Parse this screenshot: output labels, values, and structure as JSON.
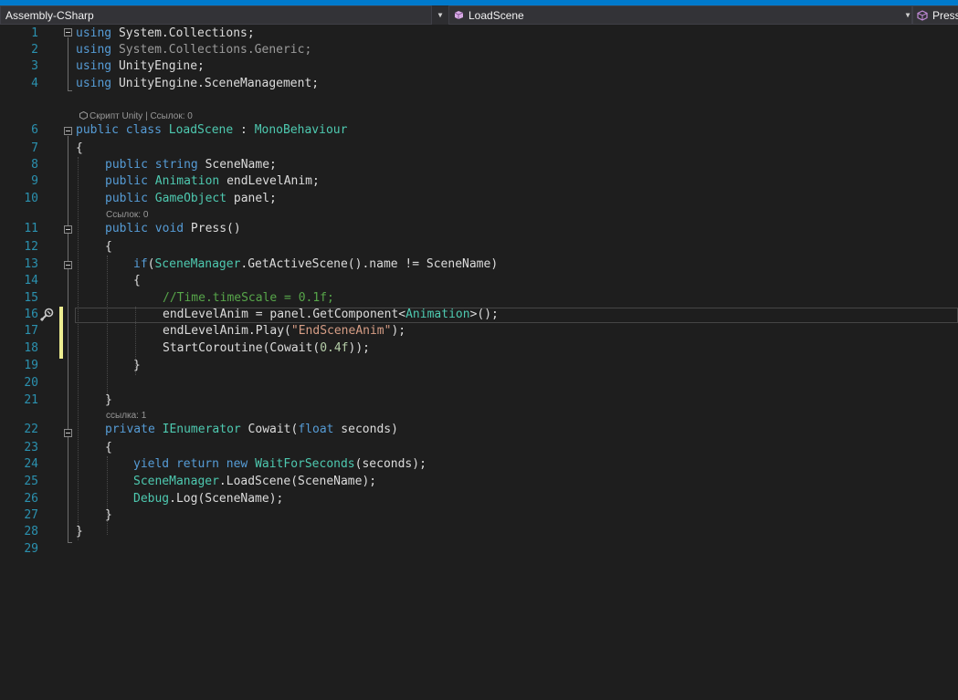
{
  "navbar": {
    "project": "Assembly-CSharp",
    "class_name": "LoadScene",
    "member": "Press"
  },
  "code_lens": {
    "class": "Скрипт Unity | Ссылок: 0",
    "press": "Ссылок: 0",
    "cowait": "ссылка: 1"
  },
  "line_numbers": [
    "1",
    "2",
    "3",
    "4",
    "6",
    "7",
    "8",
    "9",
    "10",
    "11",
    "12",
    "13",
    "14",
    "15",
    "16",
    "17",
    "18",
    "19",
    "20",
    "21",
    "22",
    "23",
    "24",
    "25",
    "26",
    "27",
    "28",
    "29"
  ],
  "code": {
    "l1": {
      "kw": "using",
      "rest": " System.Collections;"
    },
    "l2": {
      "kw": "using",
      "rest": " System.Collections.Generic;"
    },
    "l3": {
      "kw": "using",
      "rest": " UnityEngine;"
    },
    "l4": {
      "kw": "using",
      "rest": " UnityEngine.SceneManagement;"
    },
    "l6": {
      "kw": "public class",
      "sp": " ",
      "name": "LoadScene",
      "sep": " : ",
      "base": "MonoBehaviour"
    },
    "l7": {
      "text": "{"
    },
    "l8": {
      "kw": "public string",
      "rest": " SceneName;"
    },
    "l9": {
      "kw": "public",
      "sp": " ",
      "type": "Animation",
      "rest": " endLevelAnim;"
    },
    "l10": {
      "kw": "public",
      "sp": " ",
      "type": "GameObject",
      "rest": " panel;"
    },
    "l11": {
      "kw": "public void",
      "rest": " Press()"
    },
    "l12": {
      "text": "{"
    },
    "l13": {
      "kw": "if",
      "p1": "(",
      "type": "SceneManager",
      "rest": ".GetActiveScene().name != SceneName)"
    },
    "l14": {
      "text": "{"
    },
    "l15": {
      "comment": "//Time.timeScale = 0.1f;"
    },
    "l16": {
      "pre": "endLevelAnim = panel.GetComponent<",
      "type": "Animation",
      "post": ">();"
    },
    "l17": {
      "pre": "endLevelAnim.Play(",
      "str": "\"EndSceneAnim\"",
      "post": ");"
    },
    "l18": {
      "pre": "StartCoroutine(Cowait(",
      "num": "0.4f",
      "post": "));"
    },
    "l19": {
      "text": "}"
    },
    "l21": {
      "text": "}"
    },
    "l22": {
      "kw": "private",
      "sp": " ",
      "type": "IEnumerator",
      "mid": " Cowait(",
      "kw2": "float",
      "rest": " seconds)"
    },
    "l23": {
      "text": "{"
    },
    "l24": {
      "kw": "yield return new",
      "sp": " ",
      "type": "WaitForSeconds",
      "rest": "(seconds);"
    },
    "l25": {
      "type": "SceneManager",
      "rest": ".LoadScene(SceneName);"
    },
    "l26": {
      "type": "Debug",
      "rest": ".Log(SceneName);"
    },
    "l27": {
      "text": "}"
    },
    "l28": {
      "text": "}"
    }
  },
  "colors": {
    "accent": "#007acc",
    "keyword": "#569cd6",
    "type": "#4ec9b0",
    "string": "#d69d85",
    "number": "#b5cea8",
    "comment": "#57a64a",
    "line_number": "#2b91af",
    "change_marker": "#efef91"
  },
  "icons": [
    "class-icon",
    "method-icon",
    "quick-action-bulb-icon",
    "unity-icon",
    "collapse-icon"
  ]
}
